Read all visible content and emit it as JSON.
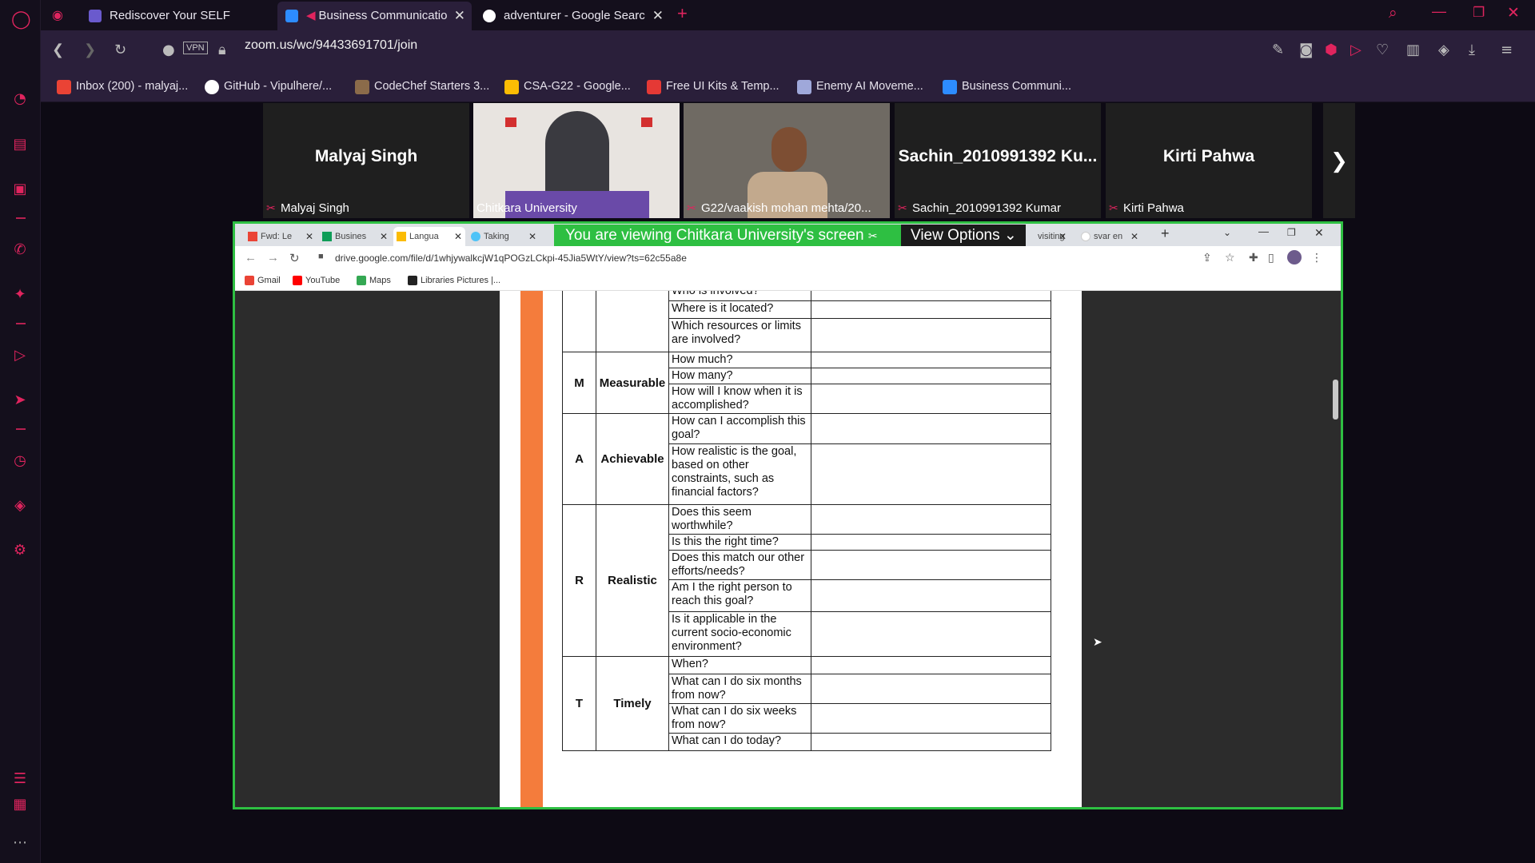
{
  "browser": {
    "tabs": [
      {
        "label": "Rediscover Your SELF",
        "color": "#6a5acd"
      },
      {
        "label": "Business Communicatio",
        "color": "#2d8cff"
      },
      {
        "label": "adventurer - Google Searc",
        "color": "#ffffff"
      }
    ],
    "url": "zoom.us/wc/94433691701/join",
    "vpn_label": "VPN",
    "bookmarks": [
      {
        "label": "Inbox (200) - malyaj...",
        "color": "#ea4335"
      },
      {
        "label": "GitHub - Vipulhere/...",
        "color": "#ffffff"
      },
      {
        "label": "CodeChef Starters 3...",
        "color": "#8b6b4a"
      },
      {
        "label": "CSA-G22 - Google...",
        "color": "#fbbc04"
      },
      {
        "label": "Free UI Kits & Temp...",
        "color": "#e53935"
      },
      {
        "label": "Enemy AI Moveme...",
        "color": "#9fa8da"
      },
      {
        "label": "Business Communi...",
        "color": "#2d8cff"
      }
    ]
  },
  "participants": [
    {
      "name": "Malyaj Singh",
      "label": "Malyaj Singh",
      "video": false
    },
    {
      "name": "",
      "label": "Chitkara University",
      "video": true
    },
    {
      "name": "",
      "label": "G22/vaakish mohan mehta/20...",
      "video": true
    },
    {
      "name": "Sachin_2010991392 Ku...",
      "label": "Sachin_2010991392 Kumar",
      "video": false
    },
    {
      "name": "Kirti Pahwa",
      "label": "Kirti Pahwa",
      "video": false
    }
  ],
  "share": {
    "banner": "You are viewing Chitkara University's screen",
    "view_options": "View Options",
    "inner_tabs": [
      "Fwd: Le",
      "Busines",
      "Langua",
      "Taking",
      "visiting",
      "svar en"
    ],
    "inner_url": "drive.google.com/file/d/1whjywalkcjW1qPOGzLCkpi-45Jia5WtY/view?ts=62c55a8e",
    "inner_bookmarks": [
      "Gmail",
      "YouTube",
      "Maps",
      "Libraries Pictures |..."
    ]
  },
  "document": {
    "rows": [
      {
        "letter": "",
        "word": "",
        "questions": [
          "Who is involved?",
          "Where is it located?",
          "Which resources or limits are involved?"
        ]
      },
      {
        "letter": "M",
        "word": "Measurable",
        "questions": [
          "How much?",
          "How many?",
          "How will I know when it is accomplished?"
        ]
      },
      {
        "letter": "A",
        "word": "Achievable",
        "questions": [
          "How can I accomplish this goal?",
          "How realistic is the goal, based on other constraints, such as financial factors?"
        ]
      },
      {
        "letter": "R",
        "word": "Realistic",
        "questions": [
          "Does this seem worthwhile?",
          "Is this the right time?",
          "Does this match our other efforts/needs?",
          "Am I the right person to reach this goal?",
          "Is it applicable in the current socio-economic environment?"
        ]
      },
      {
        "letter": "T",
        "word": "Timely",
        "questions": [
          "When?",
          "What can I do six months from now?",
          " What can I do six weeks from now?",
          "What can I do today?"
        ]
      }
    ]
  }
}
